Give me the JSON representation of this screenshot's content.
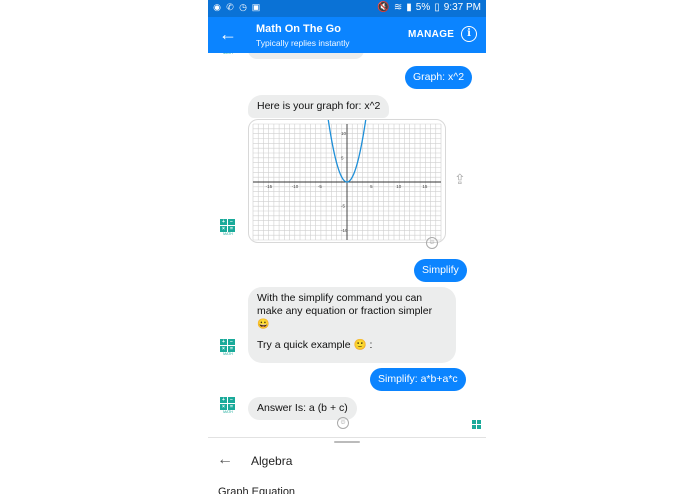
{
  "status_bar": {
    "battery": "5%",
    "time": "9:37 PM"
  },
  "header": {
    "title": "Math On The Go",
    "subtitle": "Typically replies instantly",
    "manage_label": "MANAGE",
    "info_glyph": "i",
    "back_glyph": "←"
  },
  "messages": {
    "user_graph": "Graph: x^2",
    "bot_graph_intro": "Here is your graph for:  x^2",
    "user_simplify": "Simplify",
    "bot_simplify_line1": "With the simplify command you can make any equation or fraction simpler",
    "bot_simplify_emoji1": "😀",
    "bot_simplify_line2": "Try a quick example",
    "bot_simplify_emoji2": "🙂",
    "bot_simplify_colon": " :",
    "user_example": "Simplify: a*b+a*c",
    "bot_answer": "Answer Is: a (b + c)"
  },
  "graph": {
    "x_ticks": [
      "-15",
      "-10",
      "-5",
      "5",
      "10",
      "15"
    ],
    "y_ticks": [
      "10",
      "5",
      "-5",
      "-10"
    ],
    "curve_color": "#1e8fd8"
  },
  "bottom_menu": {
    "back_glyph": "←",
    "title": "Algebra",
    "item": "Graph Equation"
  },
  "colors": {
    "brand_blue": "#0b84ff",
    "status_blue": "#0a72d6",
    "bot_avatar": "#1aaa9a"
  }
}
